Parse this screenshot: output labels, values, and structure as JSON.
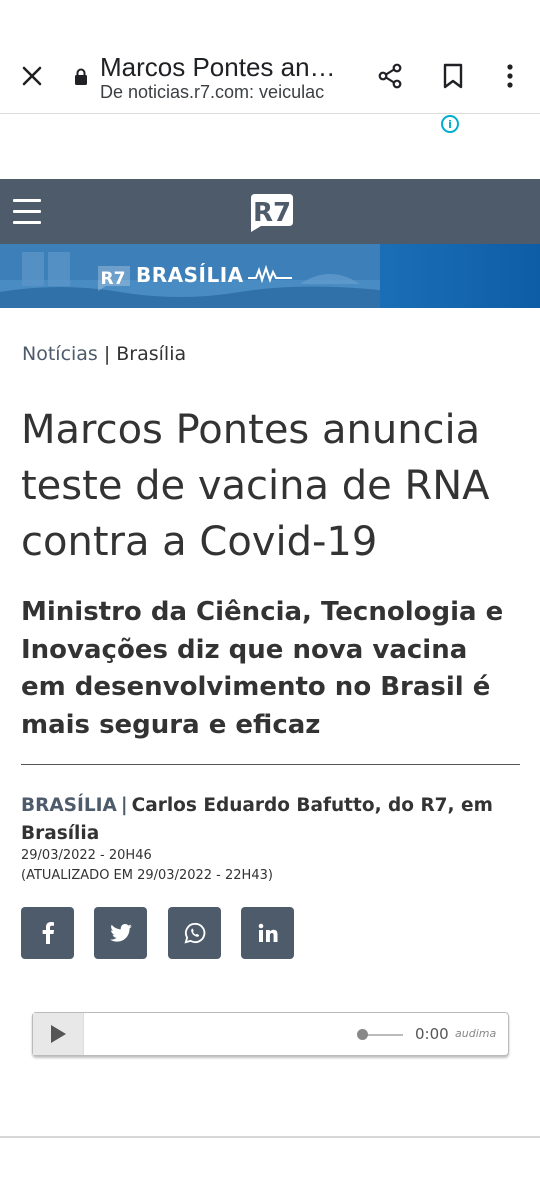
{
  "browser": {
    "title": "Marcos Pontes an…",
    "url": "De noticias.r7.com: veiculac"
  },
  "ad": {
    "info_symbol": "i"
  },
  "site": {
    "logo_text": "R7",
    "banner_badge": "R7",
    "banner_label": "BRASÍLIA",
    "header_color": "#4e5b6b",
    "accent_color": "#4e5b6b"
  },
  "article": {
    "breadcrumb": {
      "section": "Notícias",
      "separator": "|",
      "subsection": "Brasília"
    },
    "headline": "Marcos Pontes anuncia teste de vacina de RNA contra a Covid-19",
    "subtitle": "Ministro  da Ciência, Tecnologia e Inovações diz que nova vacina em desenvolvimento no Brasil é mais segura e eficaz",
    "byline": {
      "place": "BRASÍLIA",
      "separator": "|",
      "author": "Carlos Eduardo Bafutto, do R7, em Brasília"
    },
    "published": "29/03/2022 - 20H46",
    "updated": "(ATUALIZADO EM 29/03/2022 - 22H43)"
  },
  "share": [
    {
      "name": "facebook",
      "icon": "facebook-icon"
    },
    {
      "name": "twitter",
      "icon": "twitter-icon"
    },
    {
      "name": "whatsapp",
      "icon": "whatsapp-icon"
    },
    {
      "name": "linkedin",
      "icon": "linkedin-icon"
    }
  ],
  "player": {
    "time": "0:00",
    "brand": "audima",
    "progress": 0
  }
}
